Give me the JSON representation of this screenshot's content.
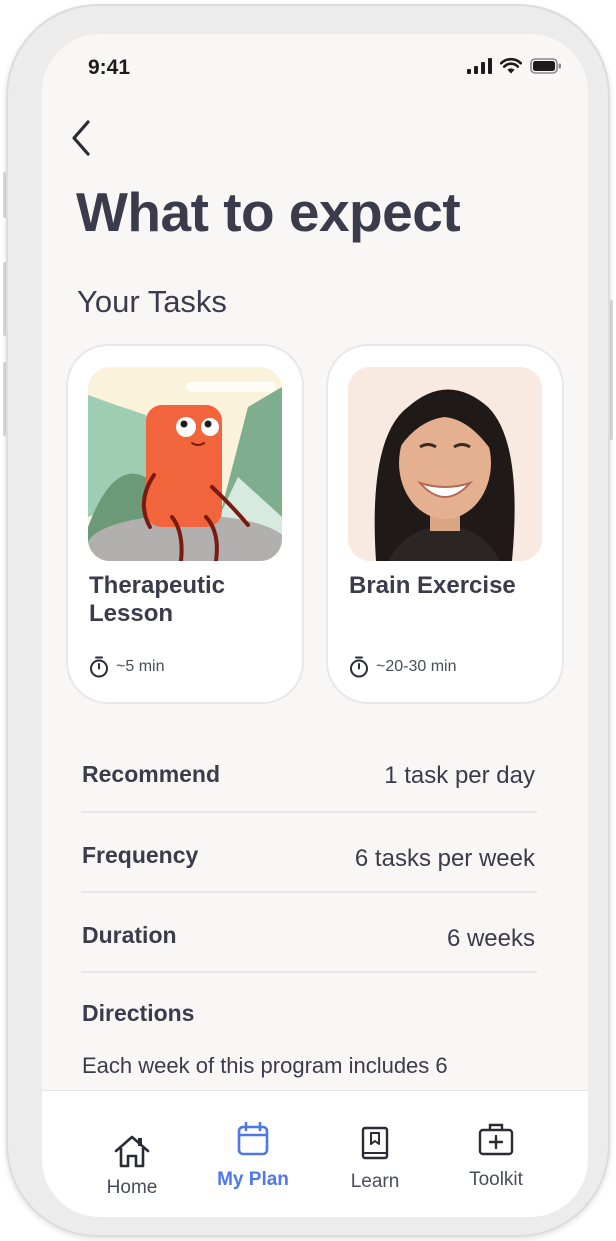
{
  "status_bar": {
    "time": "9:41"
  },
  "page": {
    "title": "What to expect",
    "section_title": "Your Tasks"
  },
  "tasks": [
    {
      "name": "Therapeutic Lesson",
      "duration": "~5 min"
    },
    {
      "name": "Brain Exercise",
      "duration": "~20-30 min"
    }
  ],
  "details": [
    {
      "label": "Recommend",
      "value": "1 task per day"
    },
    {
      "label": "Frequency",
      "value": "6 tasks per week"
    },
    {
      "label": "Duration",
      "value": "6 weeks"
    }
  ],
  "directions": {
    "label": "Directions",
    "text": "Each week of this program includes 6"
  },
  "tab_bar": {
    "items": [
      {
        "label": "Home",
        "icon": "home-icon",
        "active": false
      },
      {
        "label": "My Plan",
        "icon": "calendar-icon",
        "active": true
      },
      {
        "label": "Learn",
        "icon": "book-icon",
        "active": false
      },
      {
        "label": "Toolkit",
        "icon": "toolkit-icon",
        "active": false
      }
    ]
  },
  "colors": {
    "accent": "#4d78e8",
    "text": "#3a3c4c",
    "background": "#f9f7f6"
  }
}
